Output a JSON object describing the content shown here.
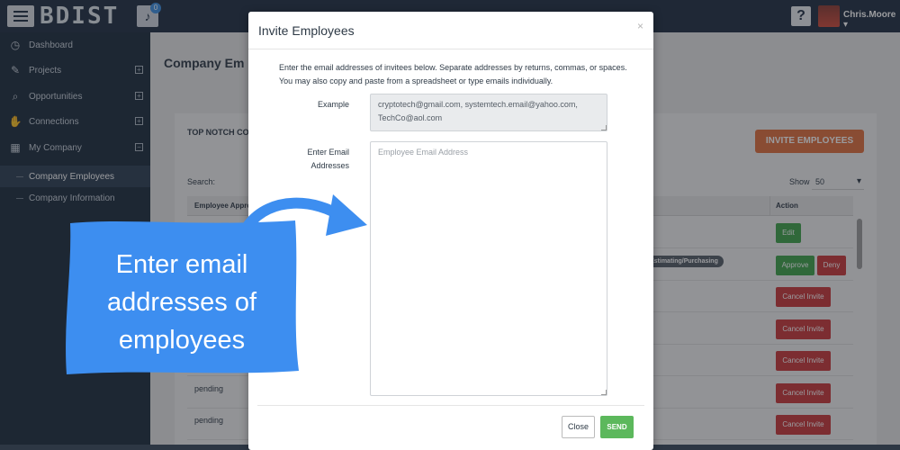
{
  "topbar": {
    "logo_text": "BDIST",
    "notification_count": "0",
    "help_label": "?",
    "user_name": "Chris.Moore ▾"
  },
  "sidebar": {
    "items": [
      {
        "label": "Dashboard",
        "icon": "dashboard-icon",
        "glyph": "◷"
      },
      {
        "label": "Projects",
        "icon": "wrench-icon",
        "glyph": "✎",
        "toggle": "+"
      },
      {
        "label": "Opportunities",
        "icon": "search-icon",
        "glyph": "⌕",
        "toggle": "+"
      },
      {
        "label": "Connections",
        "icon": "handshake-icon",
        "glyph": "✋",
        "toggle": "+"
      },
      {
        "label": "My Company",
        "icon": "building-icon",
        "glyph": "▦",
        "toggle": "−"
      }
    ],
    "sub_items": [
      {
        "label": "Company Employees",
        "active": true
      },
      {
        "label": "Company Information",
        "active": false
      }
    ]
  },
  "main": {
    "page_title": "Company Em",
    "panel_title": "TOP NOTCH CO",
    "invite_button": "INVITE EMPLOYEES",
    "search_label": "Search:",
    "show_label": "Show",
    "show_value": "50",
    "table": {
      "col_first": "Employee Appro",
      "col_action": "Action",
      "rows": [
        {
          "status": "",
          "role": "",
          "actions": [
            "Edit"
          ]
        },
        {
          "status": "",
          "role": "Estimating/Purchasing",
          "actions": [
            "Approve",
            "Deny"
          ]
        },
        {
          "status": "",
          "role": "",
          "actions": [
            "Cancel Invite"
          ]
        },
        {
          "status": "",
          "role": "",
          "actions": [
            "Cancel Invite"
          ]
        },
        {
          "status": "",
          "role": "",
          "actions": [
            "Cancel Invite"
          ]
        },
        {
          "status": "pending",
          "role": "",
          "actions": [
            "Cancel Invite"
          ]
        },
        {
          "status": "pending",
          "role": "",
          "actions": [
            "Cancel Invite"
          ]
        }
      ]
    }
  },
  "modal": {
    "title": "Invite Employees",
    "close_glyph": "×",
    "description": "Enter the email addresses of invitees below. Separate addresses by returns, commas, or spaces. You may also copy and paste from a spreadsheet or type emails individually.",
    "example_label": "Example",
    "example_value": "cryptotech@gmail.com, systemtech.email@yahoo.com, TechCo@aol.com",
    "email_label": "Enter Email Addresses",
    "email_placeholder": "Employee Email Address",
    "email_value": "",
    "close_button": "Close",
    "send_button": "SEND"
  },
  "callout": {
    "text": "Enter email addresses of employees",
    "color": "#3d8ef0"
  }
}
